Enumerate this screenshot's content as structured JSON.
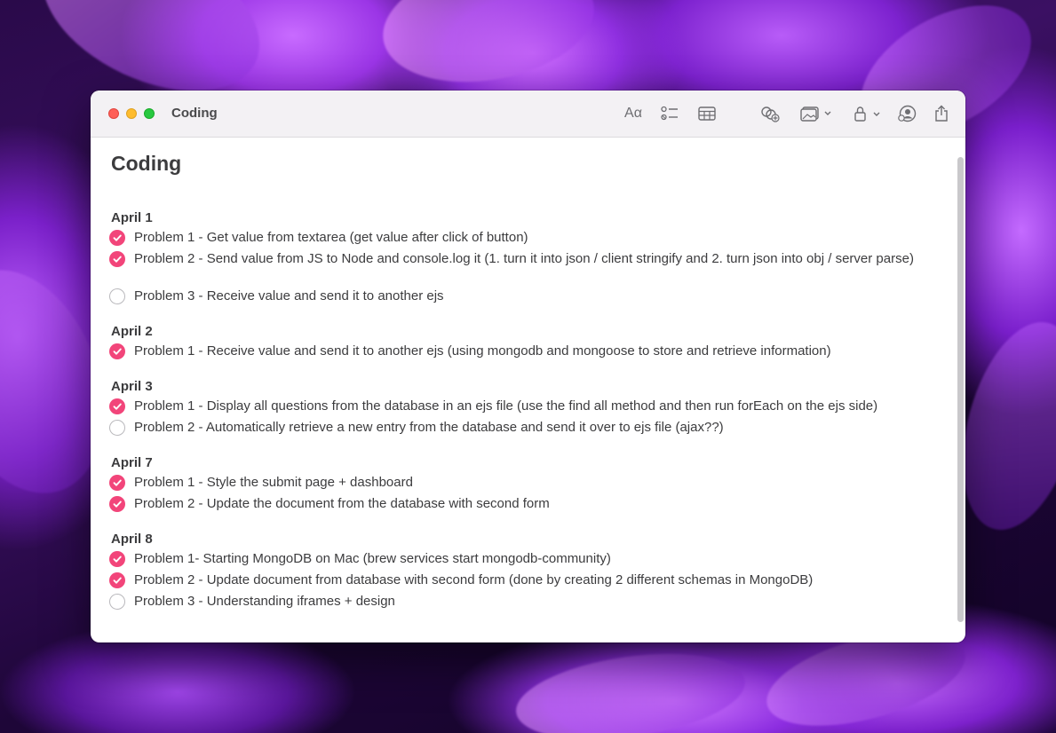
{
  "window": {
    "title": "Coding"
  },
  "toolbar": {
    "icons": [
      "format-text-icon",
      "checklist-icon",
      "table-icon",
      "link-icon",
      "media-icon",
      "lock-icon",
      "collaborate-icon",
      "share-icon"
    ],
    "format_label": "Aα"
  },
  "note": {
    "title": "Coding",
    "sections": [
      {
        "heading": "April 1",
        "items": [
          {
            "text": "Problem 1 - Get value from textarea (get value after click of button)",
            "done": true
          },
          {
            "text": "Problem 2 - Send value from JS to Node and console.log it (1. turn it into json / client stringify and 2. turn json into obj / server parse)",
            "done": true
          },
          {
            "text": "Problem 3 - Receive value and send it to another ejs",
            "done": false
          }
        ]
      },
      {
        "heading": "April 2",
        "items": [
          {
            "text": "Problem 1 - Receive value and send it to another ejs (using mongodb and mongoose to store and retrieve information)",
            "done": true
          }
        ]
      },
      {
        "heading": "April 3",
        "items": [
          {
            "text": "Problem 1 - Display all questions from the database in an ejs file (use the find all method and then run forEach on the ejs side)",
            "done": true
          },
          {
            "text": "Problem 2 - Automatically retrieve a new entry from the database and send it over to ejs file (ajax??)",
            "done": false
          }
        ]
      },
      {
        "heading": "April 7",
        "items": [
          {
            "text": "Problem 1 - Style the submit page + dashboard",
            "done": true
          },
          {
            "text": "Problem 2 - Update the document from the database with second form",
            "done": true
          }
        ]
      },
      {
        "heading": "April 8",
        "items": [
          {
            "text": "Problem 1- Starting MongoDB on Mac (brew services start mongodb-community)",
            "done": true
          },
          {
            "text": "Problem 2 - Update document from database with second form (done by creating 2 different schemas in MongoDB)",
            "done": true
          },
          {
            "text": "Problem 3 - Understanding iframes + design",
            "done": false
          }
        ]
      }
    ]
  },
  "colors": {
    "checked": "#f2457a",
    "unchecked_border": "#b9b8bc",
    "text": "#3c3c3e"
  }
}
